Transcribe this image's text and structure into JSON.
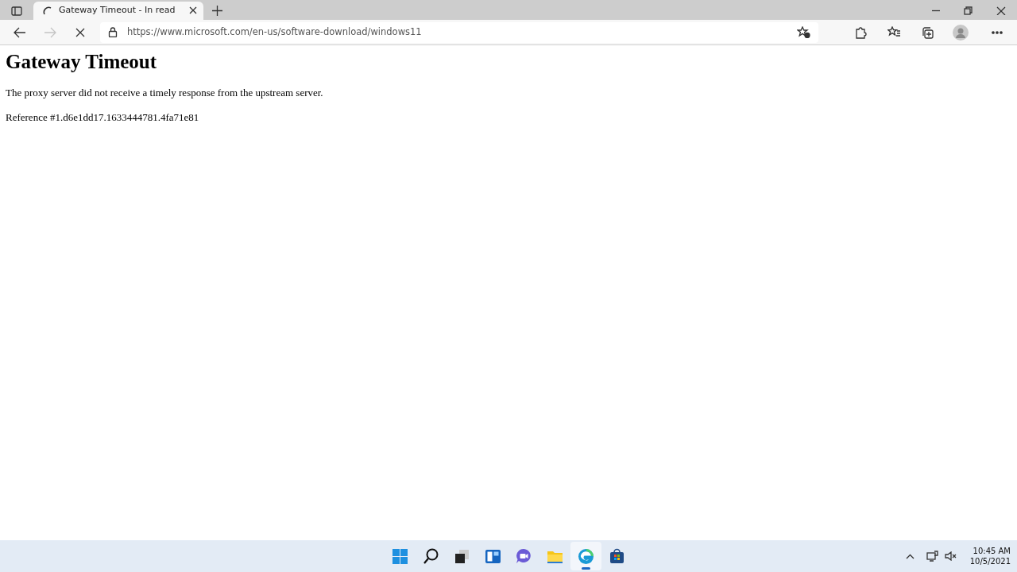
{
  "browser": {
    "tabs": [
      {
        "title": "Gateway Timeout - In read",
        "selected": true,
        "loading": true
      }
    ],
    "address": "https://www.microsoft.com/en-us/software-download/windows11",
    "loading": true
  },
  "page": {
    "heading": "Gateway Timeout",
    "message": "The proxy server did not receive a timely response from the upstream server.",
    "reference": "Reference #1.d6e1dd17.1633444781.4fa71e81"
  },
  "taskbar": {
    "apps": [
      {
        "kind": "start",
        "selected": false
      },
      {
        "kind": "search",
        "selected": false
      },
      {
        "kind": "taskview",
        "selected": false
      },
      {
        "kind": "widgets",
        "selected": false
      },
      {
        "kind": "chat",
        "selected": false
      },
      {
        "kind": "files",
        "selected": false
      },
      {
        "kind": "edge",
        "selected": true
      },
      {
        "kind": "store",
        "selected": false
      }
    ],
    "time": "10:45 AM",
    "date": "10/5/2021"
  }
}
